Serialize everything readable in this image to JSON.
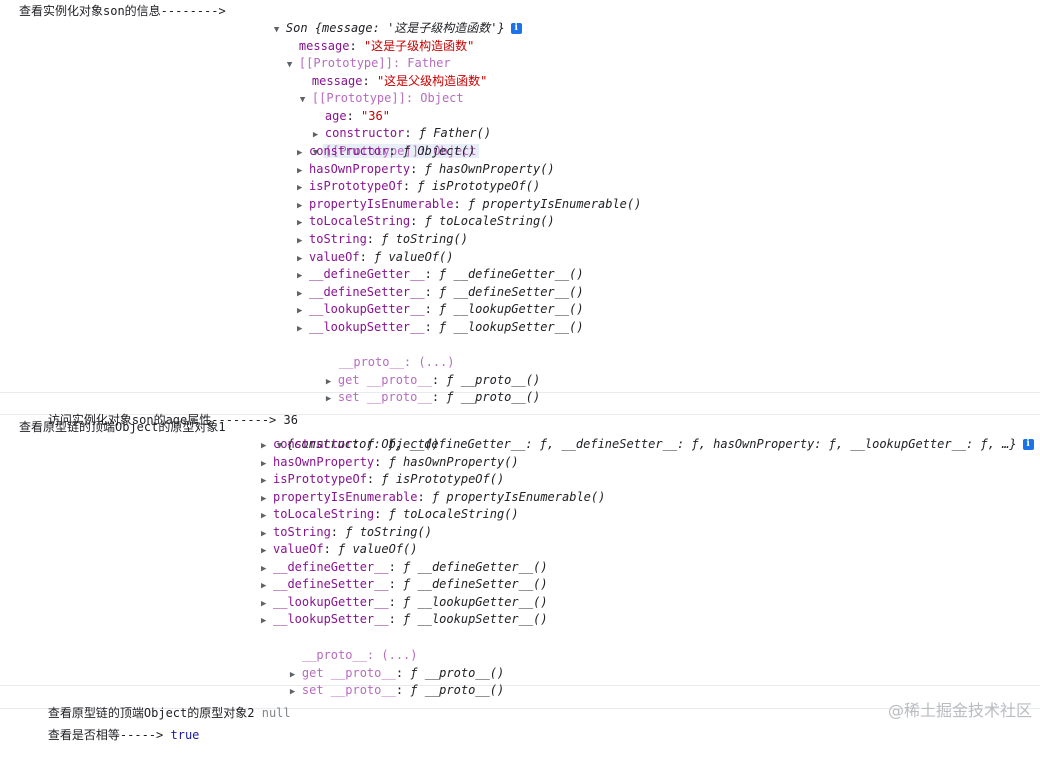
{
  "log1": {
    "label": "查看实例化对象son的信息-------->",
    "header_class": "Son",
    "header_props": "{message: '这是子级构造函数'}",
    "message_key": "message",
    "message_val": "\"这是子级构造函数\"",
    "proto_father": "[[Prototype]]: Father",
    "father_message_key": "message",
    "father_message_val": "\"这是父级构造函数\"",
    "proto_object": "[[Prototype]]: Object",
    "age_key": "age",
    "age_val": "\"36\"",
    "constructor_key": "constructor",
    "constructor_val": "ƒ Father()",
    "proto_object2": "[[Prototype]]: Object",
    "object_proto_items": [
      {
        "key": "constructor",
        "val": "ƒ Object()"
      },
      {
        "key": "hasOwnProperty",
        "val": "ƒ hasOwnProperty()"
      },
      {
        "key": "isPrototypeOf",
        "val": "ƒ isPrototypeOf()"
      },
      {
        "key": "propertyIsEnumerable",
        "val": "ƒ propertyIsEnumerable()"
      },
      {
        "key": "toLocaleString",
        "val": "ƒ toLocaleString()"
      },
      {
        "key": "toString",
        "val": "ƒ toString()"
      },
      {
        "key": "valueOf",
        "val": "ƒ valueOf()"
      },
      {
        "key": "__defineGetter__",
        "val": "ƒ __defineGetter__()"
      },
      {
        "key": "__defineSetter__",
        "val": "ƒ __defineSetter__()"
      },
      {
        "key": "__lookupGetter__",
        "val": "ƒ __lookupGetter__()"
      },
      {
        "key": "__lookupSetter__",
        "val": "ƒ __lookupSetter__()"
      }
    ],
    "proto_accessor": "__proto__: (...)",
    "get_proto": "get __proto__",
    "get_proto_val": "ƒ __proto__()",
    "set_proto": "set __proto__",
    "set_proto_val": "ƒ __proto__()"
  },
  "log2": {
    "label": "访问实例化对象son的age属性-------->",
    "value": "36"
  },
  "log3": {
    "label": "查看原型链的顶端Object的原型对象1",
    "header": "{constructor: ƒ, __defineGetter__: ƒ, __defineSetter__: ƒ, hasOwnProperty: ƒ, __lookupGetter__: ƒ, …}",
    "items": [
      {
        "key": "constructor",
        "val": "ƒ Object()"
      },
      {
        "key": "hasOwnProperty",
        "val": "ƒ hasOwnProperty()"
      },
      {
        "key": "isPrototypeOf",
        "val": "ƒ isPrototypeOf()"
      },
      {
        "key": "propertyIsEnumerable",
        "val": "ƒ propertyIsEnumerable()"
      },
      {
        "key": "toLocaleString",
        "val": "ƒ toLocaleString()"
      },
      {
        "key": "toString",
        "val": "ƒ toString()"
      },
      {
        "key": "valueOf",
        "val": "ƒ valueOf()"
      },
      {
        "key": "__defineGetter__",
        "val": "ƒ __defineGetter__()"
      },
      {
        "key": "__defineSetter__",
        "val": "ƒ __defineSetter__()"
      },
      {
        "key": "__lookupGetter__",
        "val": "ƒ __lookupGetter__()"
      },
      {
        "key": "__lookupSetter__",
        "val": "ƒ __lookupSetter__()"
      }
    ],
    "proto_accessor": "__proto__: (...)",
    "get_proto": "get __proto__",
    "get_proto_val": "ƒ __proto__()",
    "set_proto": "set __proto__",
    "set_proto_val": "ƒ __proto__()"
  },
  "log4": {
    "label": "查看原型链的顶端Object的原型对象2",
    "value": "null"
  },
  "log5": {
    "label": "查看是否相等----->",
    "value": "true"
  },
  "watermark": "@稀土掘金技术社区"
}
